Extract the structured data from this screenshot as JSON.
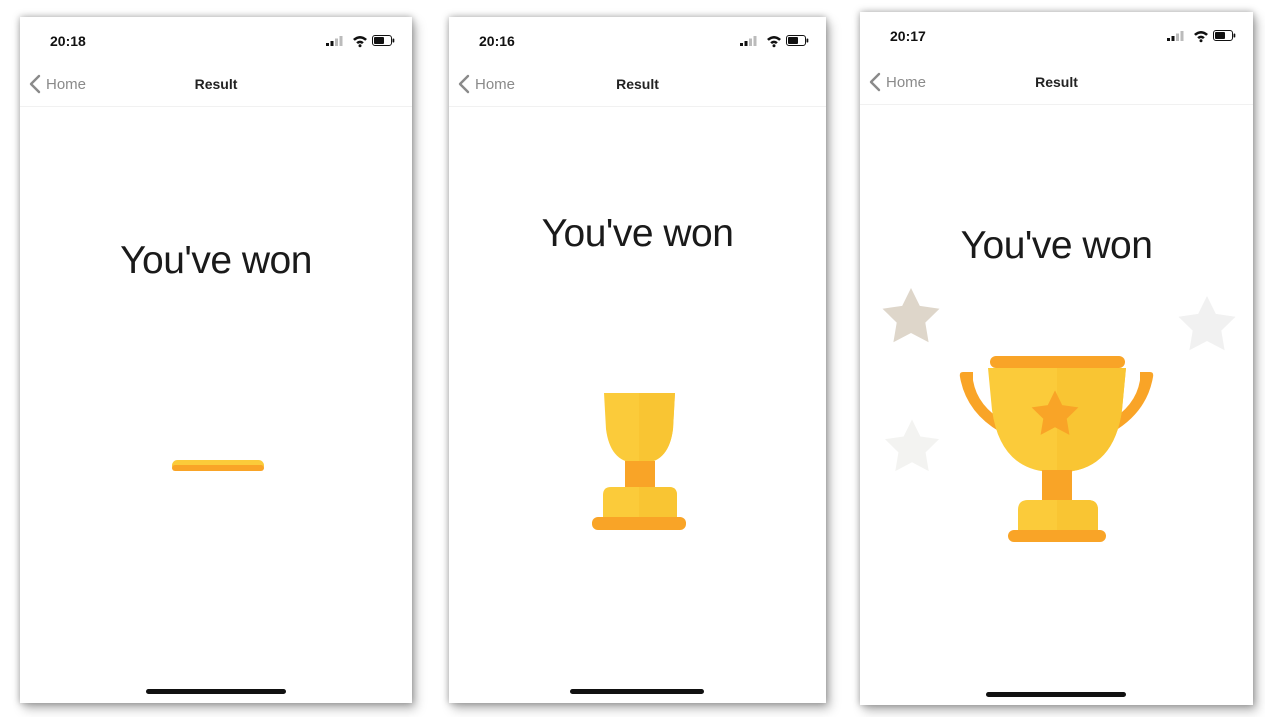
{
  "colors": {
    "trophy_light": "#fbcb3a",
    "trophy_dark": "#f9a427",
    "star_beige": "#ded6ca",
    "star_light": "#f1f1f1",
    "text": "#1a1a1a",
    "nav_back": "#8a8a8a"
  },
  "screens": [
    {
      "status_time": "20:18",
      "nav": {
        "back_label": "Home",
        "title": "Result"
      },
      "message": "You've won",
      "animation_state": "trophy-flat-line"
    },
    {
      "status_time": "20:16",
      "nav": {
        "back_label": "Home",
        "title": "Result"
      },
      "message": "You've won",
      "animation_state": "trophy-narrow"
    },
    {
      "status_time": "20:17",
      "nav": {
        "back_label": "Home",
        "title": "Result"
      },
      "message": "You've won",
      "animation_state": "trophy-full-with-stars"
    }
  ]
}
